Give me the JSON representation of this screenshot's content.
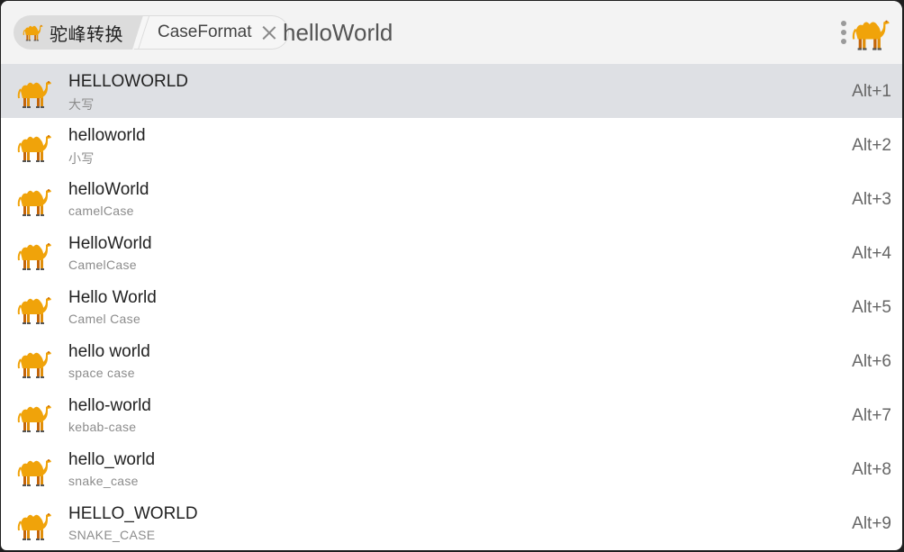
{
  "header": {
    "plugin_tag": "驼峰转换",
    "feature_tag": "CaseFormat",
    "search_value": "helloWorld",
    "icons": {
      "plugin": "camel-icon",
      "close": "close-icon",
      "menu": "more-vertical-icon",
      "logo": "camel-icon"
    }
  },
  "colors": {
    "camel_body": "#f0a30a",
    "camel_shade": "#d68a0a",
    "camel_leg_dark": "#c4650a",
    "selected_row": "#dee0e4",
    "header_bg": "#f3f3f3"
  },
  "results": [
    {
      "title": "HELLOWORLD",
      "subtitle": "大写",
      "shortcut": "Alt+1",
      "selected": true
    },
    {
      "title": "helloworld",
      "subtitle": "小写",
      "shortcut": "Alt+2",
      "selected": false
    },
    {
      "title": "helloWorld",
      "subtitle": "camelCase",
      "shortcut": "Alt+3",
      "selected": false
    },
    {
      "title": "HelloWorld",
      "subtitle": "CamelCase",
      "shortcut": "Alt+4",
      "selected": false
    },
    {
      "title": "Hello World",
      "subtitle": "Camel Case",
      "shortcut": "Alt+5",
      "selected": false
    },
    {
      "title": "hello world",
      "subtitle": "space case",
      "shortcut": "Alt+6",
      "selected": false
    },
    {
      "title": "hello-world",
      "subtitle": "kebab-case",
      "shortcut": "Alt+7",
      "selected": false
    },
    {
      "title": "hello_world",
      "subtitle": "snake_case",
      "shortcut": "Alt+8",
      "selected": false
    },
    {
      "title": "HELLO_WORLD",
      "subtitle": "SNAKE_CASE",
      "shortcut": "Alt+9",
      "selected": false
    }
  ]
}
